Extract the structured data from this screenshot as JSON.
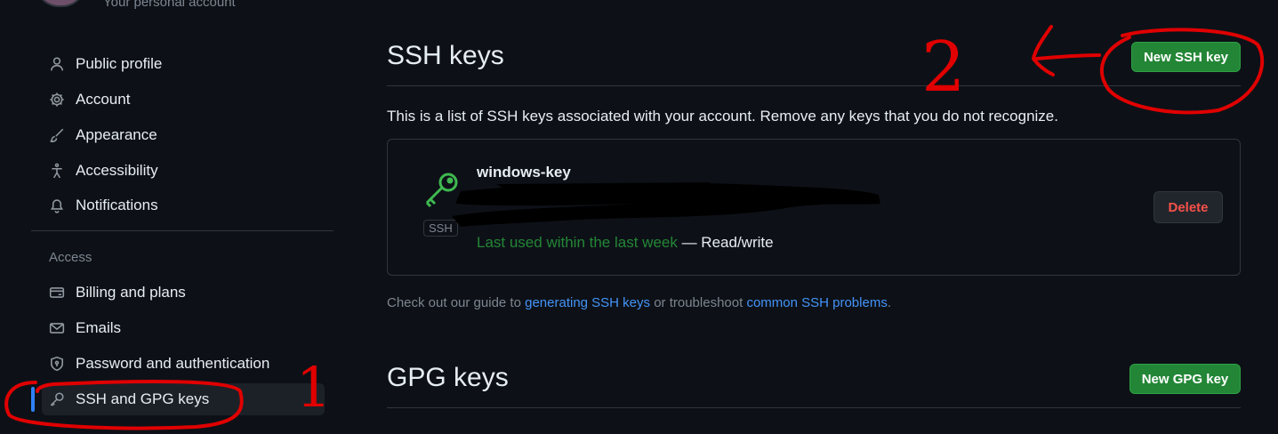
{
  "header": {
    "subtitle": "Your personal account"
  },
  "sidebar": {
    "items": [
      {
        "label": "Public profile",
        "icon": "person-icon"
      },
      {
        "label": "Account",
        "icon": "gear-icon"
      },
      {
        "label": "Appearance",
        "icon": "paintbrush-icon"
      },
      {
        "label": "Accessibility",
        "icon": "accessibility-icon"
      },
      {
        "label": "Notifications",
        "icon": "bell-icon"
      }
    ],
    "access_heading": "Access",
    "access_items": [
      {
        "label": "Billing and plans",
        "icon": "credit-card-icon"
      },
      {
        "label": "Emails",
        "icon": "mail-icon"
      },
      {
        "label": "Password and authentication",
        "icon": "shield-lock-icon"
      },
      {
        "label": "SSH and GPG keys",
        "icon": "key-icon",
        "active": true
      }
    ]
  },
  "ssh": {
    "title": "SSH keys",
    "new_button": "New SSH key",
    "description": "This is a list of SSH keys associated with your account. Remove any keys that you do not recognize.",
    "key": {
      "name": "windows-key",
      "badge": "SSH",
      "last_used": "Last used within the last week",
      "access": " — Read/write",
      "delete_label": "Delete"
    },
    "guide": {
      "prefix": "Check out our guide to ",
      "link1": "generating SSH keys",
      "middle": " or troubleshoot ",
      "link2": "common SSH problems",
      "suffix": "."
    }
  },
  "gpg": {
    "title": "GPG keys",
    "new_button": "New GPG key"
  },
  "annotations": {
    "step1": "1",
    "step2": "2"
  },
  "colors": {
    "accent": "#2f81f7",
    "green": "#238636",
    "danger": "#f85149",
    "markup": "#e00000"
  }
}
